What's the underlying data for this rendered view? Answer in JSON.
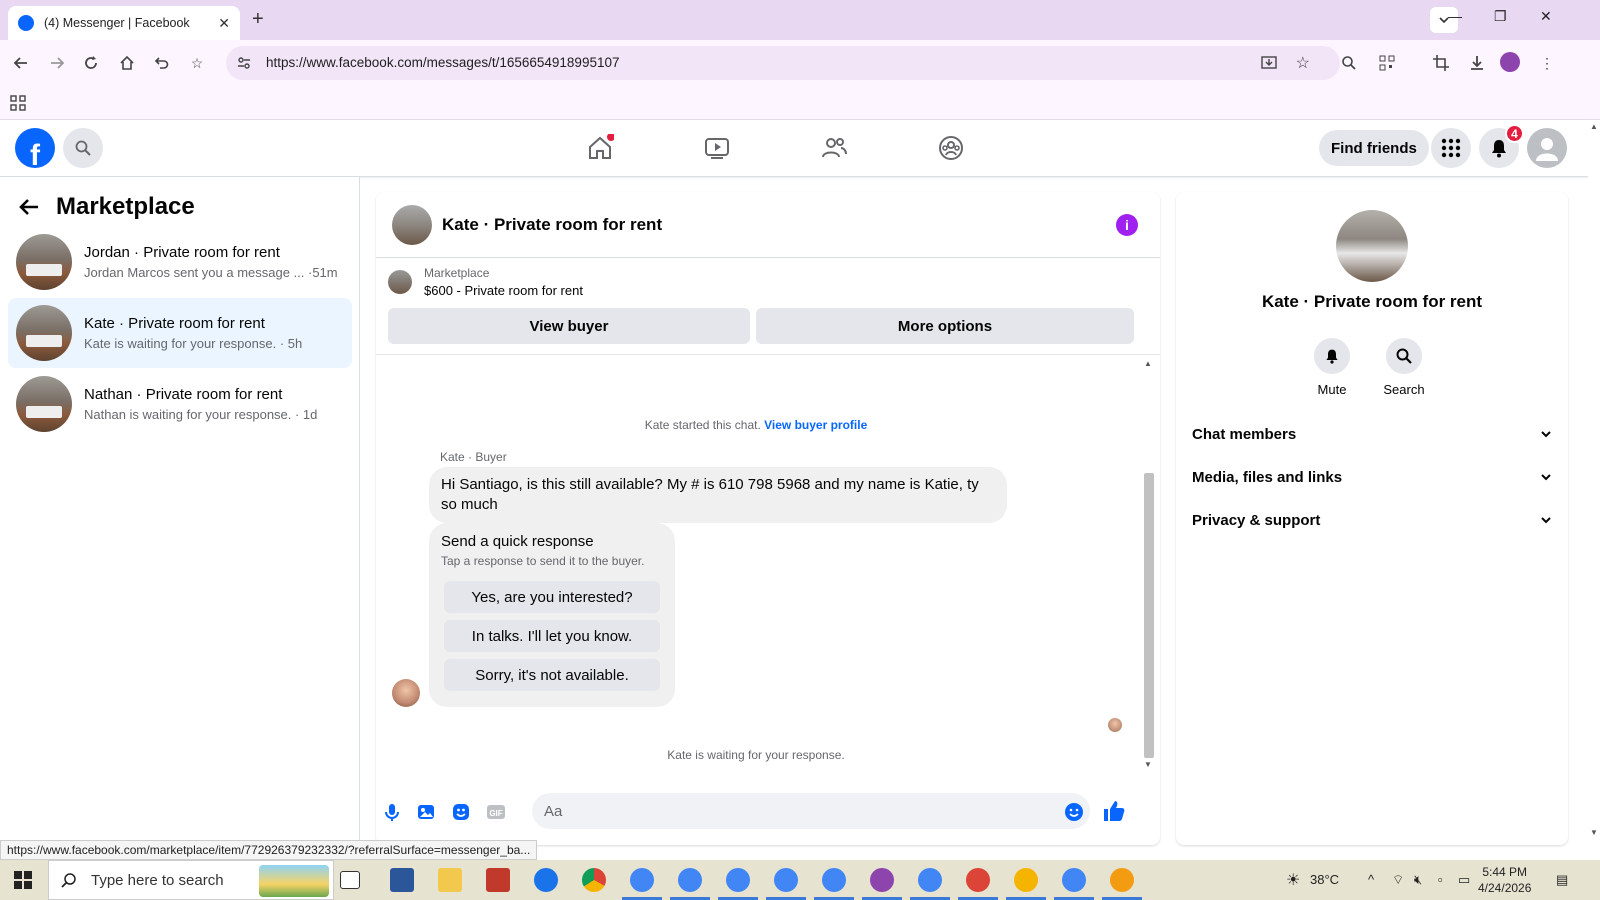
{
  "browser": {
    "tab_title": "(4) Messenger | Facebook",
    "url": "https://www.facebook.com/messages/t/1656654918995107",
    "status_url": "https://www.facebook.com/marketplace/item/772926379232332/?referralSurface=messenger_ba..."
  },
  "fbnav": {
    "logo": "f",
    "find_friends": "Find friends",
    "notifications_count": "4"
  },
  "left": {
    "title": "Marketplace",
    "conversations": [
      {
        "name": "Jordan · Private room for rent",
        "sub": "Jordan Marcos sent you a message ... ·51m"
      },
      {
        "name": "Kate · Private room for rent",
        "sub": "Kate is waiting for your response. · 5h"
      },
      {
        "name": "Nathan · Private room for rent",
        "sub": "Nathan is waiting for your response. · 1d"
      }
    ]
  },
  "chat": {
    "title": "Kate · Private room for rent",
    "marketplace_label": "Marketplace",
    "listing": "$600 - Private room for rent",
    "view_buyer": "View buyer",
    "more_options": "More options",
    "started_text": "Kate started this chat.",
    "view_profile": "View buyer profile",
    "sender": "Kate · Buyer",
    "message": "Hi Santiago, is this still available? My # is 610 798 5968 and my name is Katie, ty so much",
    "quick_title": "Send a quick response",
    "quick_sub": "Tap a response to send it to the buyer.",
    "quick_responses": [
      "Yes, are you interested?",
      "In talks. I'll let you know.",
      "Sorry, it's not available."
    ],
    "waiting": "Kate is waiting for your response.",
    "input_placeholder": "Aa"
  },
  "info": {
    "name": "Kate · Private room for rent",
    "mute": "Mute",
    "search": "Search",
    "rows": [
      "Chat members",
      "Media, files and links",
      "Privacy & support"
    ]
  },
  "taskbar": {
    "search_placeholder": "Type here to search",
    "temperature": "38°C",
    "time": "5:44 PM",
    "date": "4/24/2026"
  },
  "colors": {
    "fb_blue": "#0866ff",
    "active_conv": "#ebf5ff",
    "info_purple": "#a020f0",
    "badge_red": "#e41e3f"
  }
}
